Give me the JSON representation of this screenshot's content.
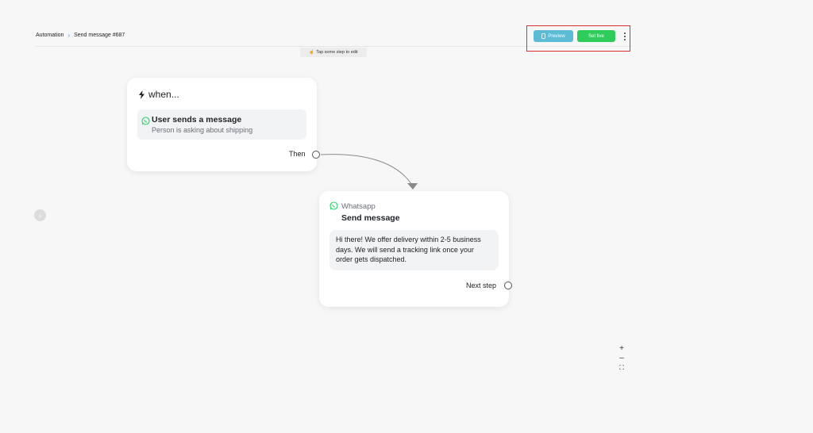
{
  "breadcrumb": {
    "root": "Automation",
    "current": "Send message #687"
  },
  "toolbar": {
    "preview_label": "Preview",
    "live_label": "Set live"
  },
  "hint": {
    "icon": "pointer-icon",
    "text": "Tap some step to edit"
  },
  "trigger_card": {
    "heading": "when...",
    "trigger_title": "User sends a message",
    "trigger_subtitle": "Person is asking about shipping",
    "port_label": "Then"
  },
  "action_card": {
    "channel": "Whatsapp",
    "title": "Send message",
    "message": "Hi there! We offer delivery within 2-5 business days. We will send a tracking link once your order gets dispatched.",
    "port_label": "Next step"
  },
  "zoom_controls": {
    "zoom_in": "+",
    "zoom_out": "–",
    "fit": "⛶"
  },
  "colors": {
    "preview_button": "#5cbcd6",
    "live_button": "#2ecc5a",
    "highlight_border": "#d93030",
    "whatsapp": "#25d366"
  }
}
